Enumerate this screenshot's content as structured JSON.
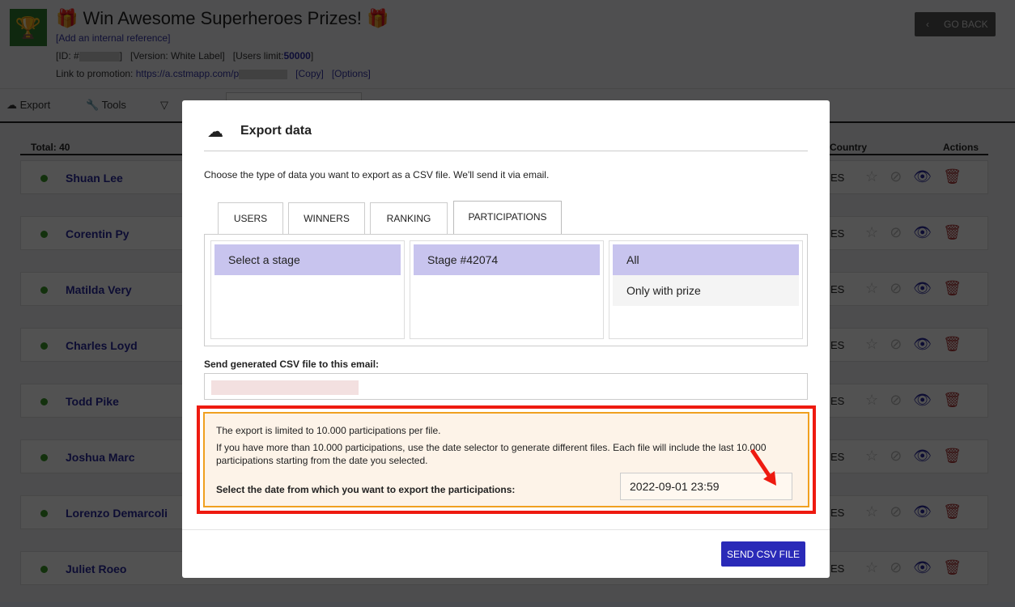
{
  "header": {
    "title": "🎁 Win Awesome Superheroes Prizes! 🎁",
    "internal_ref": "[Add an internal reference]",
    "id_label": "[ID: #",
    "version": "[Version: White Label]",
    "users_limit_label": "[Users limit:",
    "users_limit": "50000",
    "link_label": "Link to promotion:",
    "link": "https://a.cstmapp.com/p",
    "copy": "[Copy]",
    "options": "[Options]",
    "go_back": "GO BACK"
  },
  "toolbar": {
    "export": "Export",
    "tools": "Tools"
  },
  "list": {
    "total": "Total: 40",
    "country_header": "Country",
    "actions_header": "Actions",
    "rows": [
      {
        "name": "Shuan Lee",
        "country": "ES"
      },
      {
        "name": "Corentin Py",
        "country": "ES"
      },
      {
        "name": "Matilda Very",
        "country": "ES"
      },
      {
        "name": "Charles Loyd",
        "country": "ES"
      },
      {
        "name": "Todd Pike",
        "country": "ES"
      },
      {
        "name": "Joshua Marc",
        "country": "ES"
      },
      {
        "name": "Lorenzo Demarcoli",
        "country": "ES"
      },
      {
        "name": "Juliet Roeo",
        "country": "ES"
      }
    ]
  },
  "modal": {
    "title": "Export data",
    "description": "Choose the type of data you want to export as a CSV file. We'll send it via email.",
    "tabs": [
      "USERS",
      "WINNERS",
      "RANKING",
      "PARTICIPATIONS"
    ],
    "active_tab": "PARTICIPATIONS",
    "stage_col": [
      "Select a stage"
    ],
    "stage_id_col": [
      "Stage #42074"
    ],
    "filter_col": [
      "All",
      "Only with prize"
    ],
    "email_label": "Send generated CSV file to this email:",
    "warn1": "The export is limited to 10.000 participations per file.",
    "warn2": "If you have more than 10.000 participations, use the date selector to generate different files. Each file will include the last 10.000 participations starting from the date you selected.",
    "date_label": "Select the date from which you want to export the participations:",
    "date_value": "2022-09-01 23:59",
    "send": "SEND CSV FILE"
  },
  "colors": {
    "accent": "#2a2ab8",
    "highlight": "#ee1a10",
    "warning_border": "#f0a020"
  }
}
